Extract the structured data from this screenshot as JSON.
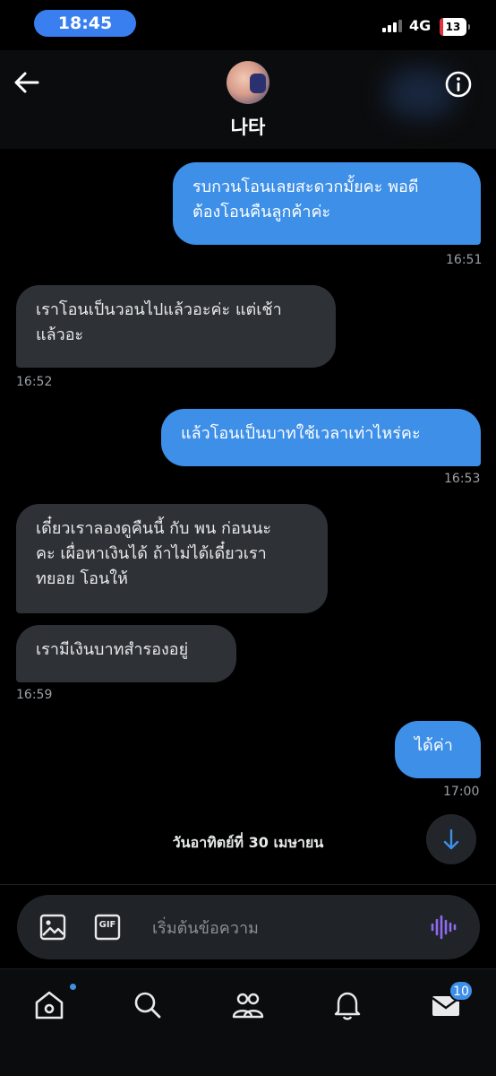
{
  "status_bar": {
    "time": "18:45",
    "network": "4G",
    "battery": "13"
  },
  "header": {
    "contact_name": "나타",
    "back_icon": "arrow-left-icon",
    "info_icon": "info-icon"
  },
  "messages": [
    {
      "direction": "outgoing",
      "lines": [
        "รบกวนโอนเลยสะดวกมั้ยคะ พอดี",
        "ต้องโอนคืนลูกค้าค่ะ"
      ],
      "time": "16:51"
    },
    {
      "direction": "incoming",
      "lines": [
        "เราโอนเป็นวอนไปแล้วอะค่ะ แต่เช้า",
        "แล้วอะ"
      ],
      "time": "16:52"
    },
    {
      "direction": "outgoing",
      "lines": [
        "แล้วโอนเป็นบาทใช้เวลาเท่าไหร่คะ"
      ],
      "time": "16:53"
    },
    {
      "direction": "incoming",
      "lines": [
        "เดี๋ยวเราลองดูคืนนี้ กับ พน ก่อนนะ",
        "คะ เผื่อหาเงินได้ ถ้าไม่ได้เดี๋ยวเรา",
        "ทยอย โอนให้"
      ],
      "time": ""
    },
    {
      "direction": "incoming",
      "lines": [
        "เรามีเงินบาทสำรองอยู่"
      ],
      "time": "16:59"
    },
    {
      "direction": "outgoing",
      "lines": [
        "ได้ค่า"
      ],
      "time": "17:00"
    }
  ],
  "date_separator": "วันอาทิตย์ที่ 30 เมษายน",
  "composer": {
    "placeholder": "เริ่มต้นข้อความ",
    "gif_label": "GIF"
  },
  "bottom_nav": {
    "messages_badge": "10"
  },
  "colors": {
    "outgoing_bubble": "#3d8fe8",
    "incoming_bubble": "#2e3136",
    "accent": "#3d8fe8"
  }
}
